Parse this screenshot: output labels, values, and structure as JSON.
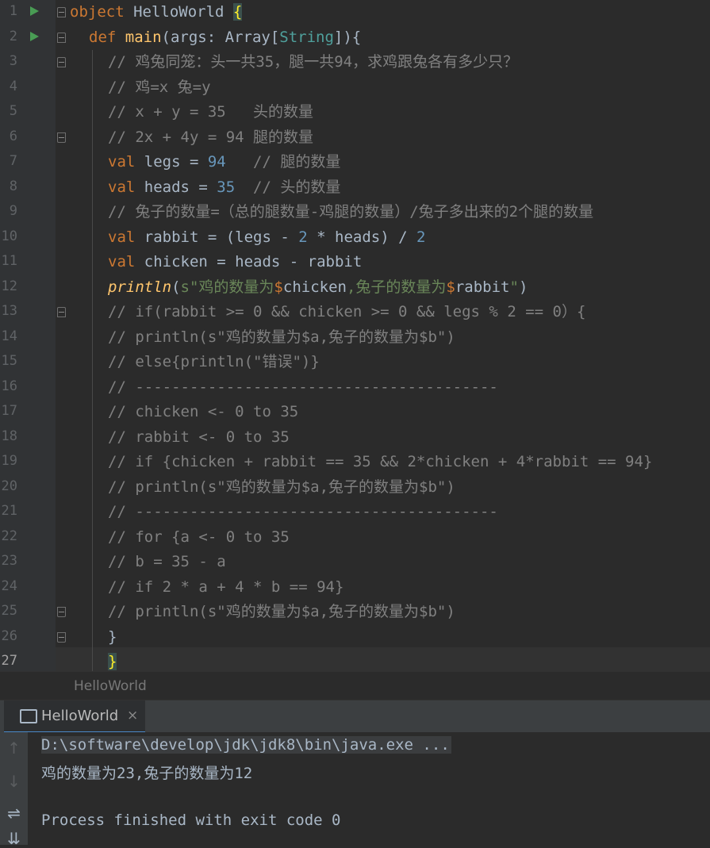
{
  "editor": {
    "line_numbers": [
      "1",
      "2",
      "3",
      "4",
      "5",
      "6",
      "7",
      "8",
      "9",
      "10",
      "11",
      "12",
      "13",
      "14",
      "15",
      "16",
      "17",
      "18",
      "19",
      "20",
      "21",
      "22",
      "23",
      "24",
      "25",
      "26",
      "27"
    ],
    "code": {
      "l1": {
        "kw": "object",
        "name": " HelloWorld ",
        "brace": "{"
      },
      "l2": {
        "kw": "def",
        "fn": "main",
        "p1": "(args: ",
        "t1": "Array",
        "p2": "[",
        "t2": "String",
        "p3": "]){"
      },
      "l3": "// 鸡兔同笼：头一共35，腿一共94，求鸡跟兔各有多少只？",
      "l4": "// 鸡=x 兔=y",
      "l5": "// x + y = 35   头的数量",
      "l6": "// 2x + 4y = 94 腿的数量",
      "l7": {
        "kw": "val",
        "a": " legs = ",
        "num": "94",
        "cm": "   // 腿的数量"
      },
      "l8": {
        "kw": "val",
        "a": " heads = ",
        "num": "35",
        "cm": "  // 头的数量"
      },
      "l9": "// 兔子的数量=（总的腿数量-鸡腿的数量）/兔子多出来的2个腿的数量",
      "l10": {
        "kw": "val",
        "a": " rabbit = (legs - ",
        "n1": "2",
        "b": " * heads) / ",
        "n2": "2"
      },
      "l11": {
        "kw": "val",
        "a": " chicken = heads - rabbit"
      },
      "l12": {
        "fn": "println",
        "p": "(",
        "s1": "s\"鸡的数量为",
        "d1": "$",
        "v1": "chicken",
        "s2": ",兔子的数量为",
        "d2": "$",
        "v2": "rabbit",
        "s3": "\"",
        "e": ")"
      },
      "l13": "// if(rabbit >= 0 && chicken >= 0 && legs % 2 == 0）{",
      "l14": "// println(s\"鸡的数量为$a,兔子的数量为$b\")",
      "l15": "// else{println(\"错误\")}",
      "l16": "// ----------------------------------------",
      "l17": "// chicken <- 0 to 35",
      "l18": "// rabbit <- 0 to 35",
      "l19": "// if {chicken + rabbit == 35 && 2*chicken + 4*rabbit == 94}",
      "l20": "// println(s\"鸡的数量为$a,兔子的数量为$b\")",
      "l21": "// ----------------------------------------",
      "l22": "// for {a <- 0 to 35",
      "l23": "// b = 35 - a",
      "l24": "// if 2 * a + 4 * b == 94}",
      "l25": "// println(s\"鸡的数量为$a,兔子的数量为$b\")",
      "l26": "}",
      "l27": "}"
    }
  },
  "breadcrumb": "HelloWorld",
  "run_panel": {
    "tab_label": "HelloWorld",
    "close_glyph": "×",
    "tool_icons": {
      "up": "↑",
      "down": "↓",
      "wrap": "⇌",
      "scroll_end": "⇊"
    },
    "output": {
      "command": "D:\\software\\develop\\jdk\\jdk8\\bin\\java.exe ...",
      "result": "鸡的数量为23,兔子的数量为12",
      "blank": "",
      "exit": "Process finished with exit code 0"
    }
  },
  "colors": {
    "background": "#2b2b2b",
    "keyword": "#cc7832",
    "function": "#ffc66d",
    "number": "#6897bb",
    "string": "#6a8759",
    "comment": "#808080",
    "run_icon": "#499c54"
  }
}
